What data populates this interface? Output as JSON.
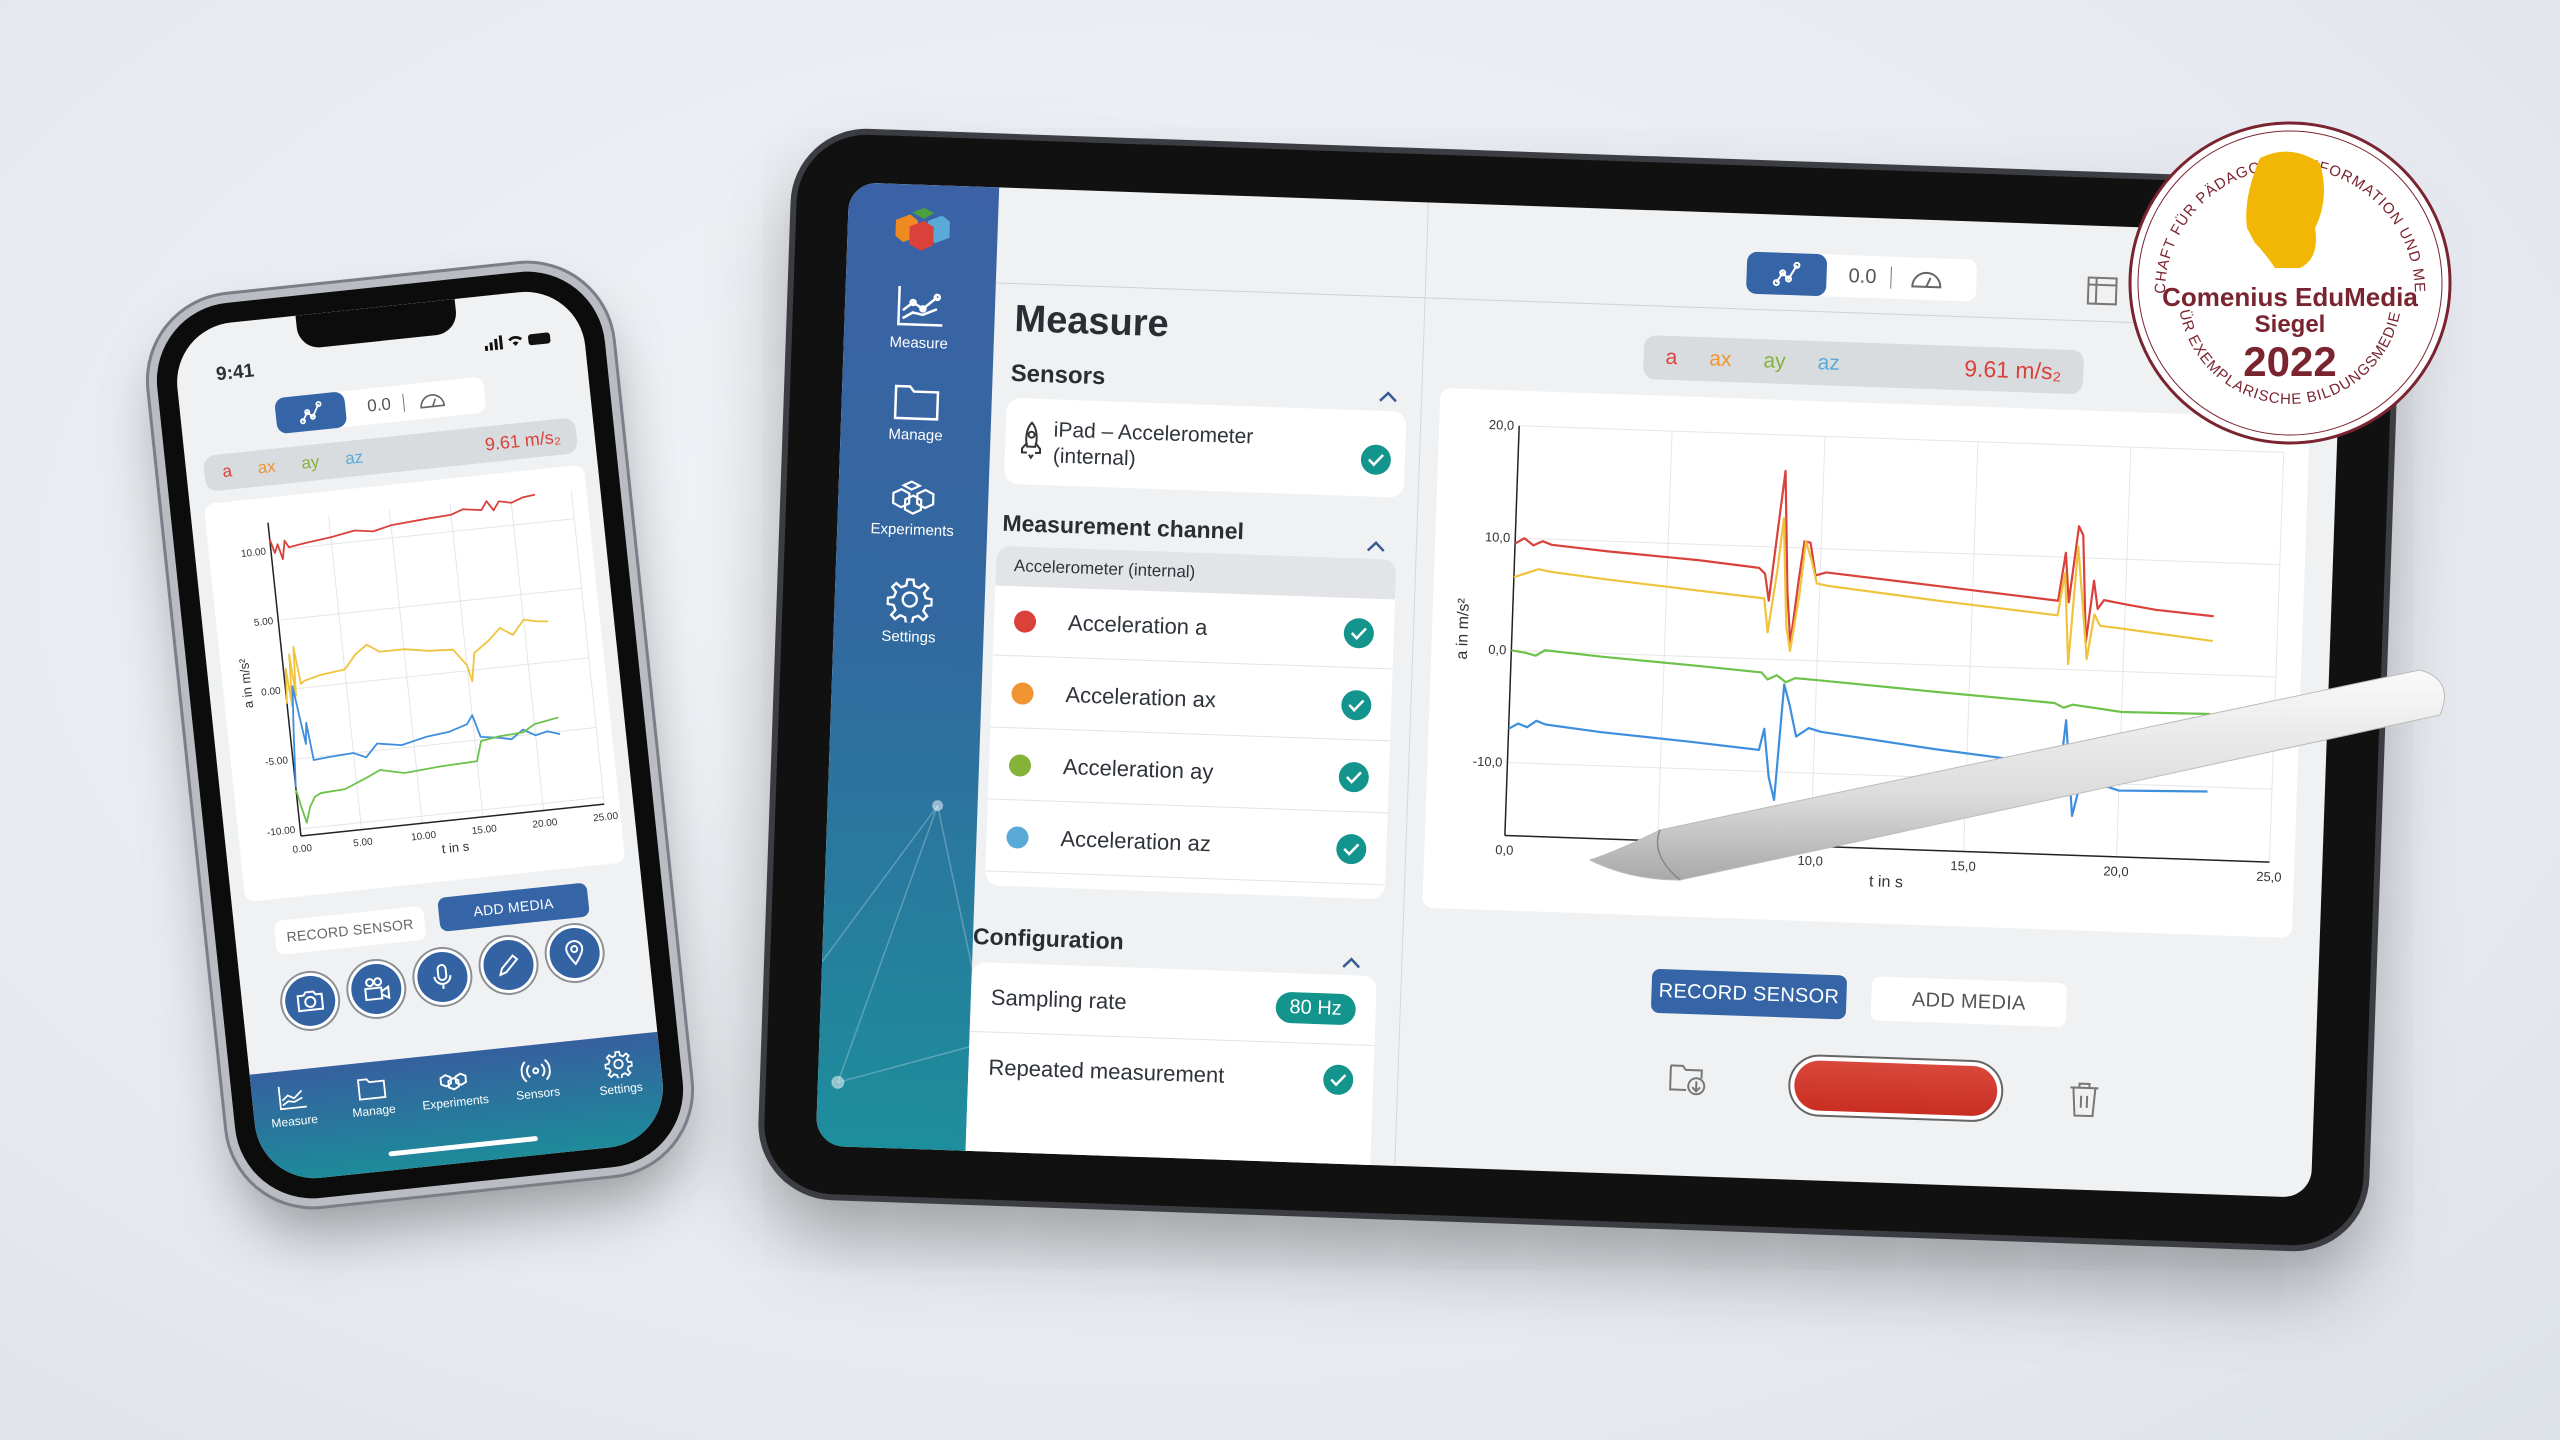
{
  "colors": {
    "brand_blue": "#3565a6",
    "teal": "#13958d",
    "record_red": "#d63a2c",
    "series_a": "#d9413a",
    "series_ax": "#f0c33c",
    "series_ay": "#6cc24a",
    "series_az": "#3e8ede",
    "seal_red": "#7a2430",
    "seal_gold": "#f2b705"
  },
  "tablet": {
    "sidebar": {
      "items": [
        {
          "label": "Measure",
          "icon": "chart-line-icon"
        },
        {
          "label": "Manage",
          "icon": "folder-icon"
        },
        {
          "label": "Experiments",
          "icon": "cubes-icon"
        },
        {
          "label": "Settings",
          "icon": "gear-icon"
        }
      ]
    },
    "title": "Measure",
    "sensors": {
      "heading": "Sensors",
      "items": [
        {
          "label_line1": "iPad – Accelerometer",
          "label_line2": "(internal)",
          "checked": true
        }
      ]
    },
    "channel": {
      "heading": "Measurement channel",
      "group": "Accelerometer (internal)",
      "items": [
        {
          "label": "Acceleration a",
          "color": "#d9413a",
          "checked": true
        },
        {
          "label": "Acceleration ax",
          "color": "#ef9430",
          "checked": true
        },
        {
          "label": "Acceleration ay",
          "color": "#86b23a",
          "checked": true
        },
        {
          "label": "Acceleration az",
          "color": "#5aaad8",
          "checked": true
        }
      ]
    },
    "config": {
      "heading": "Configuration",
      "sampling_label": "Sampling rate",
      "sampling_value": "80 Hz",
      "repeated_label": "Repeated measurement",
      "repeated_checked": true
    },
    "toolbar": {
      "value": "0.0",
      "chart_icon": "graph-icon",
      "gauge_icon": "gauge-icon",
      "table_icon": "table-icon"
    },
    "legend": {
      "a": "a",
      "ax": "ax",
      "ay": "ay",
      "az": "az",
      "reading": "9.61 m/s₂"
    },
    "buttons": {
      "record_sensor": "RECORD SENSOR",
      "add_media": "ADD MEDIA",
      "record_active": true
    }
  },
  "phone": {
    "time": "9:41",
    "toolbar": {
      "value": "0.0"
    },
    "legend": {
      "a": "a",
      "ax": "ax",
      "ay": "ay",
      "az": "az",
      "reading": "9.61 m/s₂"
    },
    "buttons": {
      "record_sensor": "RECORD SENSOR",
      "add_media": "ADD MEDIA"
    },
    "media_icons": [
      "camera-icon",
      "video-camera-icon",
      "microphone-icon",
      "pencil-icon",
      "location-pin-icon"
    ],
    "nav": [
      {
        "label": "Measure",
        "icon": "chart-line-icon"
      },
      {
        "label": "Manage",
        "icon": "folder-icon"
      },
      {
        "label": "Experiments",
        "icon": "cubes-icon"
      },
      {
        "label": "Sensors",
        "icon": "broadcast-icon"
      },
      {
        "label": "Settings",
        "icon": "gear-icon"
      }
    ]
  },
  "seal": {
    "ring_top": "GESELLSCHAFT FÜR PÄDAGOGIK, INFORMATION UND MEDIEN E.V.",
    "ring_bottom": "FÜR EXEMPLARISCHE BILDUNGSMEDIEN",
    "line1": "Comenius EduMedia",
    "line2": "Siegel",
    "year": "2022"
  },
  "chart_data": [
    {
      "id": "tablet",
      "type": "line",
      "xlabel": "t in s",
      "ylabel": "a in m/s²",
      "xlim": [
        0,
        25
      ],
      "ylim": [
        -16.5,
        20
      ],
      "xticks": [
        0,
        5,
        10,
        15,
        20,
        25
      ],
      "xtick_labels": [
        "0,0",
        "5,0",
        "10,0",
        "15,0",
        "20,0",
        "25,0"
      ],
      "yticks": [
        20,
        10,
        0,
        -10
      ],
      "ytick_labels": [
        "20,0",
        "10,0",
        "0,0",
        "-10,0"
      ],
      "grid": true,
      "series": [
        {
          "name": "a",
          "color": "#d9413a",
          "points": [
            [
              0,
              9.5
            ],
            [
              0.3,
              10
            ],
            [
              0.6,
              9.4
            ],
            [
              0.9,
              9.8
            ],
            [
              1.2,
              9.5
            ],
            [
              3,
              9.1
            ],
            [
              6,
              8.6
            ],
            [
              8,
              8.1
            ],
            [
              8.2,
              7.6
            ],
            [
              8.35,
              5.2
            ],
            [
              8.55,
              11
            ],
            [
              8.75,
              16.8
            ],
            [
              8.95,
              6
            ],
            [
              9.1,
              1.5
            ],
            [
              9.3,
              7
            ],
            [
              9.45,
              10.6
            ],
            [
              9.65,
              10.5
            ],
            [
              9.85,
              7.6
            ],
            [
              10.2,
              7.9
            ],
            [
              14,
              7
            ],
            [
              17.8,
              6.1
            ],
            [
              18.0,
              10.4
            ],
            [
              18.15,
              6
            ],
            [
              18.4,
              12.8
            ],
            [
              18.55,
              12
            ],
            [
              18.75,
              2.5
            ],
            [
              18.95,
              8
            ],
            [
              19.1,
              5.5
            ],
            [
              19.3,
              6.3
            ],
            [
              20,
              6
            ],
            [
              21,
              5.6
            ],
            [
              22.9,
              5.2
            ]
          ]
        },
        {
          "name": "ax",
          "color": "#f0c33c",
          "points": [
            [
              0,
              6.5
            ],
            [
              0.5,
              7
            ],
            [
              0.8,
              7.3
            ],
            [
              1.2,
              7.1
            ],
            [
              3,
              6.6
            ],
            [
              6,
              5.9
            ],
            [
              8.2,
              5.4
            ],
            [
              8.35,
              2.4
            ],
            [
              8.6,
              8
            ],
            [
              8.75,
              12.6
            ],
            [
              8.95,
              3
            ],
            [
              9.1,
              0.8
            ],
            [
              9.35,
              6
            ],
            [
              9.5,
              10.6
            ],
            [
              9.7,
              9
            ],
            [
              9.9,
              6.9
            ],
            [
              10.3,
              6.7
            ],
            [
              14,
              5.7
            ],
            [
              17.8,
              4.8
            ],
            [
              18.0,
              8.6
            ],
            [
              18.2,
              0.5
            ],
            [
              18.4,
              11
            ],
            [
              18.6,
              6
            ],
            [
              18.8,
              1
            ],
            [
              19.0,
              5
            ],
            [
              19.2,
              4
            ],
            [
              20,
              3.8
            ],
            [
              22.9,
              3
            ]
          ]
        },
        {
          "name": "ay",
          "color": "#6cc24a",
          "points": [
            [
              0,
              0
            ],
            [
              0.5,
              -0.2
            ],
            [
              0.8,
              -0.4
            ],
            [
              1.1,
              0.1
            ],
            [
              3,
              -0.3
            ],
            [
              6,
              -0.8
            ],
            [
              8.2,
              -1.2
            ],
            [
              8.4,
              -1.8
            ],
            [
              8.7,
              -1.4
            ],
            [
              9.0,
              -2
            ],
            [
              9.3,
              -1.6
            ],
            [
              10,
              -1.7
            ],
            [
              14,
              -2.4
            ],
            [
              17.8,
              -3
            ],
            [
              18.1,
              -3.4
            ],
            [
              18.4,
              -3.1
            ],
            [
              20,
              -3.6
            ],
            [
              22.9,
              -3.5
            ]
          ]
        },
        {
          "name": "az",
          "color": "#3e8ede",
          "points": [
            [
              0,
              -7
            ],
            [
              0.3,
              -6.5
            ],
            [
              0.6,
              -6.8
            ],
            [
              0.9,
              -6.2
            ],
            [
              1.2,
              -6.5
            ],
            [
              3,
              -7
            ],
            [
              6,
              -7.6
            ],
            [
              8.2,
              -8.1
            ],
            [
              8.35,
              -6.2
            ],
            [
              8.55,
              -10.5
            ],
            [
              8.75,
              -12.5
            ],
            [
              8.95,
              -2.2
            ],
            [
              9.15,
              -4
            ],
            [
              9.4,
              -6.8
            ],
            [
              9.8,
              -6
            ],
            [
              10.2,
              -6.3
            ],
            [
              14,
              -7.5
            ],
            [
              17.8,
              -8.5
            ],
            [
              18.0,
              -11
            ],
            [
              18.2,
              -4.5
            ],
            [
              18.5,
              -13
            ],
            [
              18.7,
              -10.5
            ],
            [
              19,
              -9.8
            ],
            [
              19.5,
              -10.2
            ],
            [
              20,
              -10.6
            ],
            [
              22.9,
              -10.4
            ]
          ]
        }
      ]
    },
    {
      "id": "phone",
      "type": "line",
      "xlabel": "t in s",
      "ylabel": "a in m/s²",
      "xlim": [
        0,
        25
      ],
      "ylim": [
        -10.5,
        12
      ],
      "xticks": [
        0,
        5,
        10,
        15,
        20,
        25
      ],
      "xtick_labels": [
        "0.00",
        "5.00",
        "10.00",
        "15.00",
        "20.00",
        "25.00"
      ],
      "yticks": [
        10,
        5,
        0,
        -5,
        -10
      ],
      "ytick_labels": [
        "10.00",
        "5.00",
        "0.00",
        "-5.00",
        "-10.00"
      ],
      "grid": true,
      "series": [
        {
          "name": "a",
          "color": "#d9413a",
          "points": [
            [
              0,
              10.8
            ],
            [
              0.3,
              9.8
            ],
            [
              0.6,
              10.4
            ],
            [
              0.9,
              9.3
            ],
            [
              1.2,
              10.6
            ],
            [
              1.5,
              10.1
            ],
            [
              3,
              10.3
            ],
            [
              5,
              10.5
            ],
            [
              7,
              10.8
            ],
            [
              8.5,
              10.6
            ],
            [
              10,
              10.9
            ],
            [
              13,
              11.1
            ],
            [
              15,
              11.2
            ],
            [
              16,
              11.5
            ],
            [
              17.5,
              11.3
            ],
            [
              18,
              11.9
            ],
            [
              18.5,
              11.2
            ],
            [
              19,
              11.8
            ],
            [
              20,
              11.6
            ],
            [
              21,
              11.9
            ],
            [
              22,
              12
            ]
          ]
        },
        {
          "name": "ax",
          "color": "#f0c33c",
          "points": [
            [
              0,
              -1
            ],
            [
              0.2,
              1.5
            ],
            [
              0.4,
              -1.2
            ],
            [
              0.6,
              2.5
            ],
            [
              0.8,
              -0.5
            ],
            [
              1.0,
              3
            ],
            [
              1.3,
              0.3
            ],
            [
              1.6,
              0.5
            ],
            [
              3,
              0.8
            ],
            [
              5,
              1
            ],
            [
              6,
              2
            ],
            [
              7,
              2.6
            ],
            [
              8,
              2
            ],
            [
              10,
              2
            ],
            [
              12,
              1.7
            ],
            [
              14,
              1.6
            ],
            [
              15,
              0.4
            ],
            [
              15.3,
              -0.8
            ],
            [
              15.7,
              1.2
            ],
            [
              17,
              2
            ],
            [
              18,
              2.8
            ],
            [
              19,
              2.2
            ],
            [
              20,
              3.2
            ],
            [
              21,
              3
            ],
            [
              22,
              2.9
            ]
          ]
        },
        {
          "name": "az",
          "color": "#3e8ede",
          "points": [
            [
              0,
              -7
            ],
            [
              0.3,
              -3
            ],
            [
              0.6,
              0.2
            ],
            [
              0.9,
              -2
            ],
            [
              1.2,
              -4
            ],
            [
              1.4,
              -2.5
            ],
            [
              1.7,
              -5.2
            ],
            [
              3,
              -5.1
            ],
            [
              5,
              -5
            ],
            [
              6,
              -5.4
            ],
            [
              7,
              -4.5
            ],
            [
              9,
              -4.8
            ],
            [
              11,
              -4.4
            ],
            [
              13,
              -4.2
            ],
            [
              14.5,
              -3.8
            ],
            [
              15,
              -3.2
            ],
            [
              15.5,
              -4.8
            ],
            [
              17,
              -5
            ],
            [
              18,
              -5.2
            ],
            [
              19,
              -4.6
            ],
            [
              20,
              -5.1
            ],
            [
              21,
              -4.9
            ],
            [
              22,
              -5.2
            ]
          ]
        },
        {
          "name": "ay",
          "color": "#6cc24a",
          "points": [
            [
              0,
              -7.2
            ],
            [
              0.3,
              -8.5
            ],
            [
              0.6,
              -9.6
            ],
            [
              1,
              -8.5
            ],
            [
              1.5,
              -7.8
            ],
            [
              2,
              -7.6
            ],
            [
              4,
              -7.5
            ],
            [
              6,
              -6.8
            ],
            [
              7,
              -6.4
            ],
            [
              8,
              -6.6
            ],
            [
              9,
              -6.8
            ],
            [
              12,
              -6.6
            ],
            [
              15,
              -6.5
            ],
            [
              15.5,
              -5.1
            ],
            [
              17,
              -4.9
            ],
            [
              19,
              -4.8
            ],
            [
              20,
              -4.3
            ],
            [
              22,
              -4
            ]
          ]
        }
      ]
    }
  ]
}
